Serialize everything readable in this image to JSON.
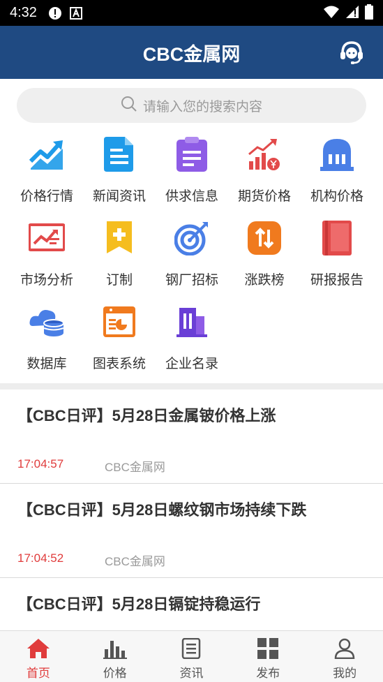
{
  "status_bar": {
    "time": "4:32"
  },
  "header": {
    "title": "CBC金属网"
  },
  "search": {
    "placeholder": "请输入您的搜索内容"
  },
  "grid": {
    "items": [
      {
        "label": "价格行情",
        "icon": "trend-chart-icon",
        "color": "#1e9be9"
      },
      {
        "label": "新闻资讯",
        "icon": "document-icon",
        "color": "#1e9be9"
      },
      {
        "label": "供求信息",
        "icon": "clipboard-icon",
        "color": "#8e5ce6"
      },
      {
        "label": "期货价格",
        "icon": "futures-chart-icon",
        "color": "#e24a4a"
      },
      {
        "label": "机构价格",
        "icon": "institution-icon",
        "color": "#4a7fe6"
      },
      {
        "label": "市场分析",
        "icon": "analysis-board-icon",
        "color": "#e24a4a"
      },
      {
        "label": "订制",
        "icon": "bookmark-plus-icon",
        "color": "#f5bd1f"
      },
      {
        "label": "钢厂招标",
        "icon": "target-icon",
        "color": "#4a7fe6"
      },
      {
        "label": "涨跌榜",
        "icon": "updown-icon",
        "color": "#f07a1e"
      },
      {
        "label": "研报报告",
        "icon": "book-icon",
        "color": "#e24a4a"
      },
      {
        "label": "数据库",
        "icon": "database-icon",
        "color": "#4a7fe6"
      },
      {
        "label": "图表系统",
        "icon": "chart-window-icon",
        "color": "#f07a1e"
      },
      {
        "label": "企业名录",
        "icon": "building-icon",
        "color": "#6a3fd6"
      }
    ]
  },
  "news": [
    {
      "title": "【CBC日评】5月28日金属铍价格上涨",
      "time": "17:04:57",
      "source": "CBC金属网"
    },
    {
      "title": "【CBC日评】5月28日螺纹钢市场持续下跌",
      "time": "17:04:52",
      "source": "CBC金属网"
    },
    {
      "title": "【CBC日评】5月28日镉锭持稳运行",
      "time": "",
      "source": ""
    }
  ],
  "tabs": [
    {
      "label": "首页",
      "icon": "home-icon",
      "active": true
    },
    {
      "label": "价格",
      "icon": "bar-chart-icon",
      "active": false
    },
    {
      "label": "资讯",
      "icon": "news-icon",
      "active": false
    },
    {
      "label": "发布",
      "icon": "grid-icon",
      "active": false
    },
    {
      "label": "我的",
      "icon": "user-icon",
      "active": false
    }
  ],
  "colors": {
    "header_bg": "#1f4a82",
    "accent": "#e03c3c"
  }
}
